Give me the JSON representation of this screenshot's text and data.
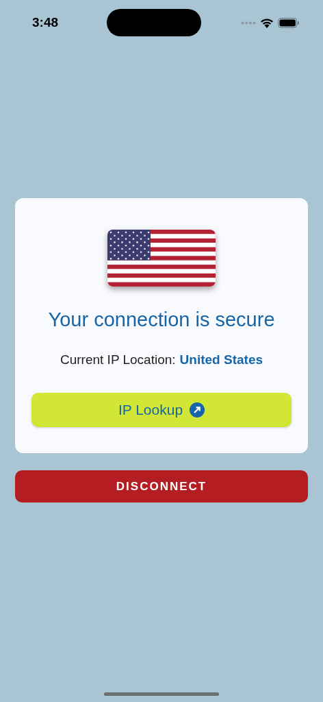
{
  "status_bar": {
    "time": "3:48"
  },
  "card": {
    "title": "Your connection is secure",
    "location_label": "Current IP Location:",
    "location_value": "United States",
    "lookup_button": "IP Lookup"
  },
  "disconnect_button": "DISCONNECT"
}
